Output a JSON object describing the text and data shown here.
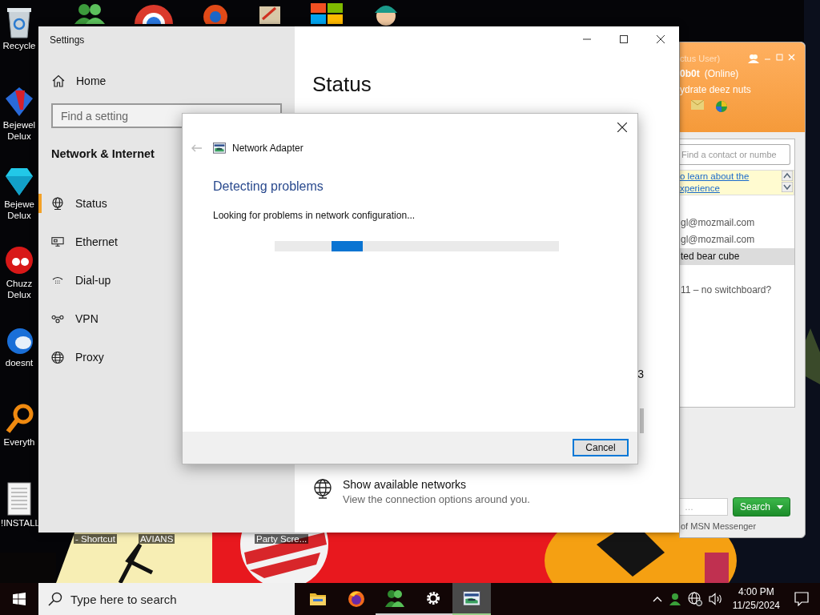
{
  "desktop": {
    "icons": [
      {
        "kind": "bin",
        "label": "Recycle"
      },
      {
        "kind": "gem2",
        "label": "Bejewel Delux"
      },
      {
        "kind": "gem",
        "label": "Bejewe Delux"
      },
      {
        "kind": "fuzz",
        "label": "Chuzz Delux"
      },
      {
        "kind": "bird",
        "label": "doesnt"
      },
      {
        "kind": "magnifier",
        "label": "Everyth"
      },
      {
        "kind": "document",
        "label": "!INSTALL"
      }
    ],
    "top_icons": [
      {
        "kind": "people"
      },
      {
        "kind": "browser"
      },
      {
        "kind": "disc"
      },
      {
        "kind": "paint"
      },
      {
        "kind": "tiles"
      },
      {
        "kind": "character"
      }
    ],
    "bottom_labels": [
      "- Shortcut",
      "AVIANS",
      "Party Scre..."
    ]
  },
  "messenger": {
    "status_line": "ctus User)",
    "name": "0b0t",
    "presence": "(Online)",
    "message": "ydrate deez nuts",
    "search": {
      "placeholder": "Find a contact or numbe"
    },
    "banner": [
      "o learn about the",
      "xperience"
    ],
    "contacts": [
      {
        "label": "gl@mozmail.com",
        "selected": false
      },
      {
        "label": "gl@mozmail.com",
        "selected": false
      },
      {
        "label": "ted bear cube",
        "selected": true
      },
      {
        "label": "11 – no switchboard?",
        "selected": false
      }
    ],
    "web_search": {
      "placeholder": "…"
    },
    "search_button": "Search",
    "footer": "of MSN Messenger"
  },
  "settings": {
    "title": "Settings",
    "home": "Home",
    "search": {
      "placeholder": "Find a setting"
    },
    "section": "Network & Internet",
    "nav": [
      {
        "kind": "status",
        "label": "Status",
        "selected": true
      },
      {
        "kind": "ethernet",
        "label": "Ethernet",
        "selected": false
      },
      {
        "kind": "dialup",
        "label": "Dial-up",
        "selected": false
      },
      {
        "kind": "vpn",
        "label": "VPN",
        "selected": false
      },
      {
        "kind": "proxy",
        "label": "Proxy",
        "selected": false
      }
    ],
    "heading": "Status",
    "fragment": "3",
    "option": {
      "title": "Show available networks",
      "description": "View the connection options around you."
    }
  },
  "dialog": {
    "title": "Network Adapter",
    "heading": "Detecting problems",
    "message": "Looking for problems in network configuration...",
    "buttons": [
      "Cancel"
    ]
  },
  "taskbar": {
    "search": {
      "placeholder": "Type here to search"
    },
    "apps": [
      {
        "kind": "folder",
        "running": false,
        "selected": false
      },
      {
        "kind": "firefox",
        "running": false,
        "selected": false
      },
      {
        "kind": "messenger",
        "running": true,
        "selected": false
      },
      {
        "kind": "gear",
        "running": true,
        "selected": false
      },
      {
        "kind": "adapter",
        "running": true,
        "selected": true
      }
    ],
    "time": "4:00 PM",
    "date": "11/25/2024"
  }
}
